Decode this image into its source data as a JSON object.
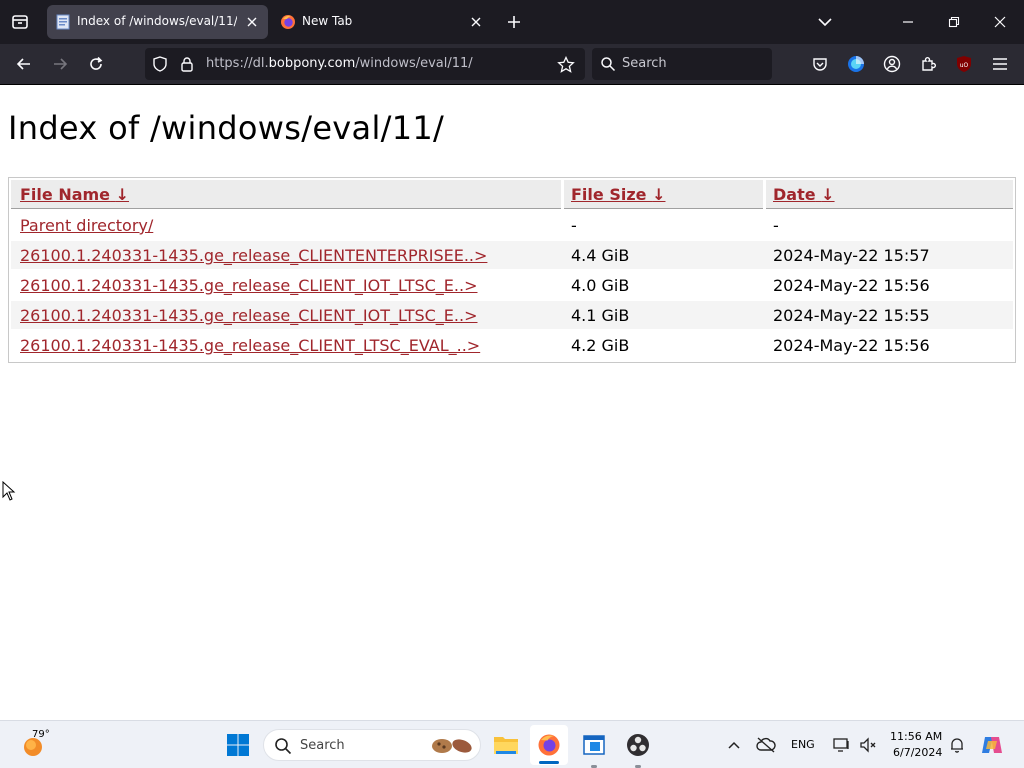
{
  "browser": {
    "tabs": [
      {
        "title": "Index of /windows/eval/11/",
        "active": true
      },
      {
        "title": "New Tab",
        "active": false
      }
    ],
    "url_prefix": "https://dl.",
    "url_domain": "bobpony.com",
    "url_path": "/windows/eval/11/",
    "search_placeholder": "Search"
  },
  "page": {
    "title": "Index of /windows/eval/11/",
    "headers": {
      "name": "File Name",
      "size": "File Size",
      "date": "Date",
      "sort_arrow": "↓"
    },
    "rows": [
      {
        "name": "Parent directory/",
        "size": "-",
        "date": "-"
      },
      {
        "name": "26100.1.240331-1435.ge_release_CLIENTENTERPRISEE..>",
        "size": "4.4 GiB",
        "date": "2024-May-22 15:57"
      },
      {
        "name": "26100.1.240331-1435.ge_release_CLIENT_IOT_LTSC_E..>",
        "size": "4.0 GiB",
        "date": "2024-May-22 15:56"
      },
      {
        "name": "26100.1.240331-1435.ge_release_CLIENT_IOT_LTSC_E..>",
        "size": "4.1 GiB",
        "date": "2024-May-22 15:55"
      },
      {
        "name": "26100.1.240331-1435.ge_release_CLIENT_LTSC_EVAL_..>",
        "size": "4.2 GiB",
        "date": "2024-May-22 15:56"
      }
    ]
  },
  "taskbar": {
    "weather_temp": "79°",
    "search_placeholder": "Search",
    "language": "ENG",
    "time": "11:56 AM",
    "date": "6/7/2024"
  },
  "colors": {
    "link": "#a0262c",
    "chrome_dark": "#1c1b22",
    "toolbar": "#2b2a33",
    "accent_blue": "#0067c0"
  }
}
